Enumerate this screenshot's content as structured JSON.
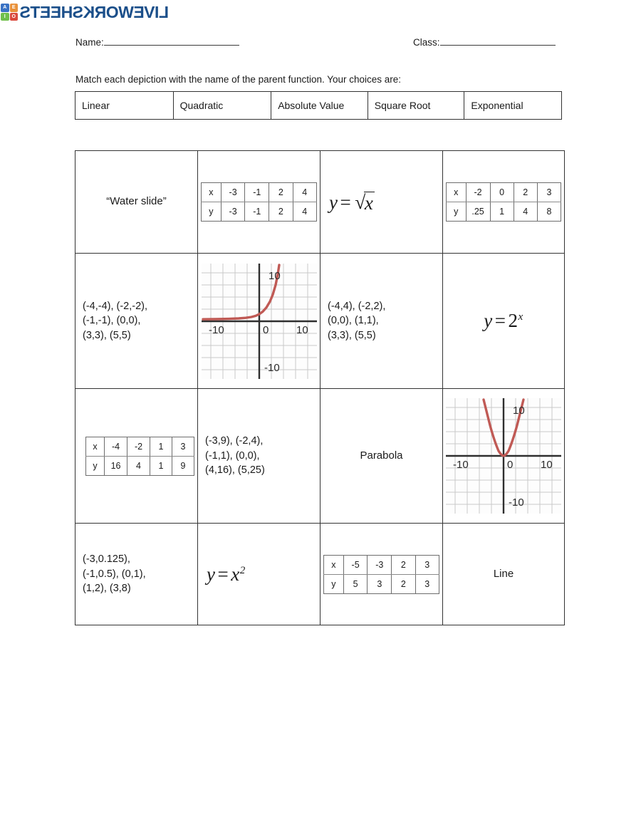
{
  "logo": {
    "squares": [
      {
        "letter": "A",
        "color": "#3a72c4"
      },
      {
        "letter": "E",
        "color": "#e8913a"
      },
      {
        "letter": "I",
        "color": "#6fbf4a"
      },
      {
        "letter": "O",
        "color": "#d94a3d"
      }
    ],
    "text": "LIVEWORKSHEETS",
    "brand_color": "#1b4f8a"
  },
  "header": {
    "name_label": "Name:",
    "class_label": "Class:"
  },
  "instruction": "Match each depiction with the name of the parent function. Your choices are:",
  "choices": [
    "Linear",
    "Quadratic",
    "Absolute Value",
    "Square Root",
    "Exponential"
  ],
  "grid": {
    "r1c1": {
      "kind": "word",
      "text": "“Water slide”"
    },
    "r1c2": {
      "kind": "table",
      "x_label": "x",
      "y_label": "y",
      "x": [
        "-3",
        "-1",
        "2",
        "4"
      ],
      "y": [
        "-3",
        "-1",
        "2",
        "4"
      ]
    },
    "r1c3": {
      "kind": "math",
      "text": "y = √x"
    },
    "r1c4": {
      "kind": "table",
      "x_label": "x",
      "y_label": "y",
      "x": [
        "-2",
        "0",
        "2",
        "3"
      ],
      "y": [
        ".25",
        "1",
        "4",
        "8"
      ]
    },
    "r2c1": {
      "kind": "coords",
      "text": "(-4,-4), (-2,-2),\n(-1,-1), (0,0),\n(3,3), (5,5)"
    },
    "r2c2": {
      "kind": "graph",
      "curve": "exponential",
      "labels": {
        "top": "10",
        "left": "-10",
        "origin": "0",
        "right": "10",
        "bottom": "-10"
      },
      "curve_color": "#c05a55",
      "grid_color": "#c9c9c9",
      "axis_color": "#2e2e2e"
    },
    "r2c3": {
      "kind": "coords",
      "text": "(-4,4), (-2,2),\n(0,0), (1,1),\n(3,3), (5,5)"
    },
    "r2c4": {
      "kind": "math",
      "text": "y = 2^x"
    },
    "r3c1": {
      "kind": "table",
      "x_label": "x",
      "y_label": "y",
      "x": [
        "-4",
        "-2",
        "1",
        "3"
      ],
      "y": [
        "16",
        "4",
        "1",
        "9"
      ]
    },
    "r3c2": {
      "kind": "coords",
      "text": "(-3,9), (-2,4),\n(-1,1), (0,0),\n(4,16), (5,25)"
    },
    "r3c3": {
      "kind": "word",
      "text": "Parabola"
    },
    "r3c4": {
      "kind": "graph",
      "curve": "parabola",
      "labels": {
        "top": "10",
        "left": "-10",
        "origin": "0",
        "right": "10",
        "bottom": "-10"
      },
      "curve_color": "#c05a55",
      "grid_color": "#c9c9c9",
      "axis_color": "#2e2e2e"
    },
    "r4c1": {
      "kind": "coords",
      "text": "(-3,0.125),\n(-1,0.5), (0,1),\n(1,2), (3,8)"
    },
    "r4c2": {
      "kind": "math",
      "text": "y = x^2"
    },
    "r4c3": {
      "kind": "table",
      "x_label": "x",
      "y_label": "y",
      "x": [
        "-5",
        "-3",
        "2",
        "3"
      ],
      "y": [
        "5",
        "3",
        "2",
        "3"
      ]
    },
    "r4c4": {
      "kind": "word",
      "text": "Line"
    }
  },
  "chart_data": [
    {
      "type": "line",
      "title": "",
      "xlabel": "",
      "ylabel": "",
      "xlim": [
        -12,
        12
      ],
      "ylim": [
        -12,
        12
      ],
      "xticks": [
        -10,
        0,
        10
      ],
      "yticks": [
        10,
        -10
      ],
      "grid": true,
      "legend": "none",
      "series": [
        {
          "name": "y = 2^x",
          "x": [
            -12,
            -10,
            -8,
            -6,
            -4,
            -2,
            -1,
            0,
            1,
            2,
            3,
            3.3
          ],
          "y": [
            0.0002,
            0.001,
            0.004,
            0.016,
            0.063,
            0.25,
            0.5,
            1,
            2,
            4,
            8,
            11
          ]
        }
      ]
    },
    {
      "type": "line",
      "title": "",
      "xlabel": "",
      "ylabel": "",
      "xlim": [
        -12,
        12
      ],
      "ylim": [
        -12,
        12
      ],
      "xticks": [
        -10,
        0,
        10
      ],
      "yticks": [
        10,
        -10
      ],
      "grid": true,
      "legend": "none",
      "series": [
        {
          "name": "y = x^2",
          "x": [
            -3.4,
            -3,
            -2.5,
            -2,
            -1.5,
            -1,
            -0.5,
            0,
            0.5,
            1,
            1.5,
            2,
            2.5,
            3,
            3.4
          ],
          "y": [
            11.6,
            9,
            6.25,
            4,
            2.25,
            1,
            0.25,
            0,
            0.25,
            1,
            2.25,
            4,
            6.25,
            9,
            11.6
          ]
        }
      ]
    }
  ]
}
